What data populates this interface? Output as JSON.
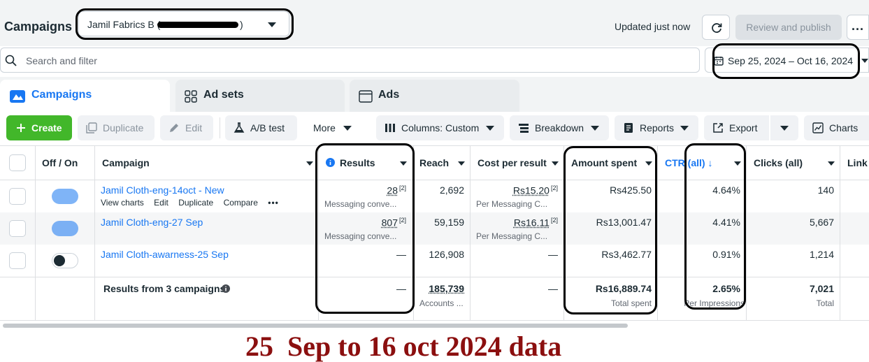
{
  "header": {
    "title": "Campaigns",
    "account_name": "Jamil Fabrics B (",
    "account_suffix": ")",
    "updated": "Updated just now",
    "review_publish": "Review and publish",
    "more": "..."
  },
  "search": {
    "placeholder": "Search and filter"
  },
  "date_range": "Sep 25, 2024 – Oct 16, 2024",
  "tabs": [
    {
      "label": "Campaigns",
      "active": true
    },
    {
      "label": "Ad sets",
      "active": false
    },
    {
      "label": "Ads",
      "active": false
    }
  ],
  "toolbar": {
    "create": "Create",
    "duplicate": "Duplicate",
    "edit": "Edit",
    "ab_test": "A/B test",
    "more": "More",
    "columns": "Columns: Custom",
    "breakdown": "Breakdown",
    "reports": "Reports",
    "export": "Export",
    "charts": "Charts"
  },
  "table": {
    "columns": {
      "off_on": "Off / On",
      "campaign": "Campaign",
      "results": "Results",
      "reach": "Reach",
      "cost_per_result": "Cost per result",
      "amount_spent": "Amount spent",
      "ctr": "CTR (all) ↓",
      "clicks": "Clicks (all)",
      "link": "Link"
    },
    "row_actions": {
      "view_charts": "View charts",
      "edit": "Edit",
      "duplicate": "Duplicate",
      "compare": "Compare",
      "more": "•••"
    },
    "rows": [
      {
        "campaign": "Jamil Cloth-eng-14oct - New",
        "status": "on",
        "results": "28",
        "results_sup": "[2]",
        "results_sub": "Messaging conve...",
        "reach": "2,692",
        "cost_per_result": "Rs15.20",
        "cost_sup": "[2]",
        "cost_sub": "Per Messaging C...",
        "amount_spent": "Rs425.50",
        "ctr": "4.64%",
        "clicks": "140"
      },
      {
        "campaign": "Jamil Cloth-eng-27 Sep",
        "status": "on",
        "results": "807",
        "results_sup": "[2]",
        "results_sub": "Messaging conve...",
        "reach": "59,159",
        "cost_per_result": "Rs16.11",
        "cost_sup": "[2]",
        "cost_sub": "Per Messaging C...",
        "amount_spent": "Rs13,001.47",
        "ctr": "4.41%",
        "clicks": "5,667"
      },
      {
        "campaign": "Jamil Cloth-awarness-25 Sep",
        "status": "off",
        "results": "—",
        "reach": "126,908",
        "cost_per_result": "—",
        "amount_spent": "Rs3,462.77",
        "ctr": "0.91%",
        "clicks": "1,214"
      }
    ],
    "totals": {
      "label": "Results from 3 campaigns",
      "results": "—",
      "reach": "185,739",
      "reach_sub": "Accounts ...",
      "cost_per_result": "—",
      "amount_spent": "Rs16,889.74",
      "amount_sub": "Total spent",
      "ctr": "2.65%",
      "ctr_sub": "Per Impressions",
      "clicks": "7,021",
      "clicks_sub": "Total"
    }
  },
  "caption": "25  Sep to 16 oct 2024 data",
  "colors": {
    "accent_blue": "#1877f2",
    "create_green": "#42b72a",
    "caption_red": "#8b0f0f"
  }
}
